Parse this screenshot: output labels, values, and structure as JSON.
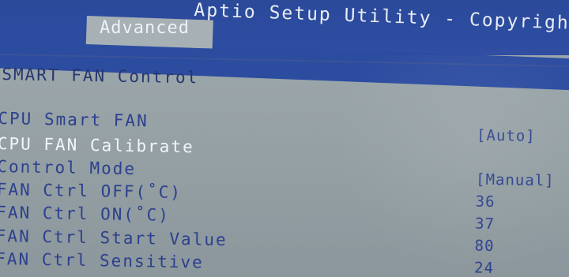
{
  "header": {
    "app_title": "Aptio Setup Utility - Copyright",
    "active_tab": "Advanced"
  },
  "section": {
    "title": "SMART FAN Control"
  },
  "settings": [
    {
      "label": "CPU Smart FAN",
      "value": ""
    },
    {
      "label": "CPU FAN Calibrate",
      "value": "[Auto]",
      "selected": true
    },
    {
      "label": "Control Mode",
      "value": ""
    },
    {
      "label": "FAN Ctrl OFF(˚C)",
      "value": "[Manual]"
    },
    {
      "label": "FAN Ctrl ON(˚C)",
      "value": "36"
    },
    {
      "label": "FAN Ctrl Start Value",
      "value": "37"
    },
    {
      "label": "FAN Ctrl Sensitive",
      "value": "80"
    }
  ],
  "extra_values": {
    "last_value": "24"
  },
  "colors": {
    "header_bg": "#2c4ca0",
    "body_bg": "#98a3a7",
    "text": "#2c408e",
    "selected_text": "#f2f5fa"
  }
}
